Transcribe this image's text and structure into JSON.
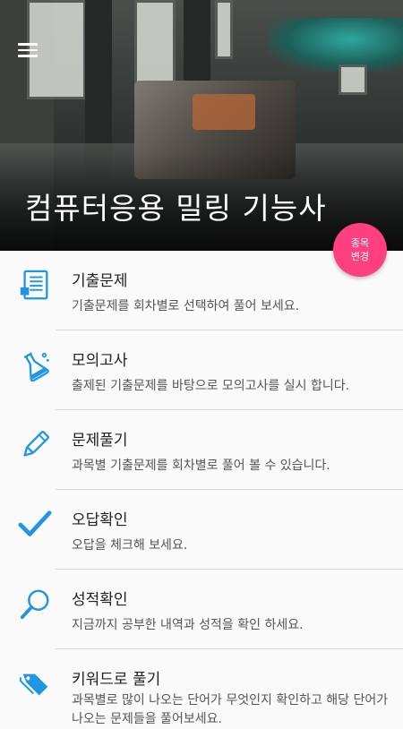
{
  "header": {
    "title": "컴퓨터응용 밀링 기능사",
    "change_button": [
      "종목",
      "변경"
    ]
  },
  "colors": {
    "accent": "#1f95e5",
    "fab": "#ff3f7f"
  },
  "menu": [
    {
      "icon": "document-icon",
      "label": "기출문제",
      "desc": "기출문제를 회차별로 선택하여 풀어 보세요."
    },
    {
      "icon": "flask-icon",
      "label": "모의고사",
      "desc": "출제된 기출문제를 바탕으로 모의고사를 실시 합니다."
    },
    {
      "icon": "pencil-icon",
      "label": "문제풀기",
      "desc": "과목별 기출문제를 회차별로 풀어 볼 수 있습니다."
    },
    {
      "icon": "checkmark-icon",
      "label": "오답확인",
      "desc": "오답을 체크해 보세요."
    },
    {
      "icon": "magnifier-icon",
      "label": "성적확인",
      "desc": "지금까지 공부한 내역과 성적을 확인 하세요."
    },
    {
      "icon": "tag-icon",
      "label": "키워드로 풀기",
      "desc": "과목별로 많이 나오는 단어가 무엇인지 확인하고 해당 단어가 나오는 문제들을 풀어보세요."
    }
  ]
}
